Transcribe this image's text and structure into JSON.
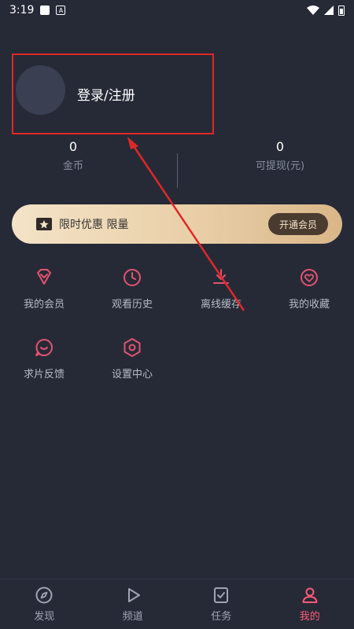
{
  "status_bar": {
    "time": "3:19"
  },
  "profile": {
    "login_label": "登录/注册"
  },
  "stats": [
    {
      "value": "0",
      "label": "金币"
    },
    {
      "value": "0",
      "label": "可提现(元)"
    }
  ],
  "vip_banner": {
    "text": "限时优惠 限量",
    "button_label": "开通会员"
  },
  "menu_items": [
    {
      "label": "我的会员",
      "icon": "diamond-icon"
    },
    {
      "label": "观看历史",
      "icon": "clock-icon"
    },
    {
      "label": "离线缓存",
      "icon": "download-icon"
    },
    {
      "label": "我的收藏",
      "icon": "heart-icon"
    },
    {
      "label": "求片反馈",
      "icon": "chat-icon"
    },
    {
      "label": "设置中心",
      "icon": "settings-icon"
    }
  ],
  "tabs": [
    {
      "label": "发现",
      "icon": "compass-icon",
      "active": false
    },
    {
      "label": "频道",
      "icon": "play-icon",
      "active": false
    },
    {
      "label": "任务",
      "icon": "task-icon",
      "active": false
    },
    {
      "label": "我的",
      "icon": "user-icon",
      "active": true
    }
  ],
  "colors": {
    "background": "#262a37",
    "accent": "#ff5a79",
    "icon": "#e4536f",
    "annotation": "#e02828"
  }
}
